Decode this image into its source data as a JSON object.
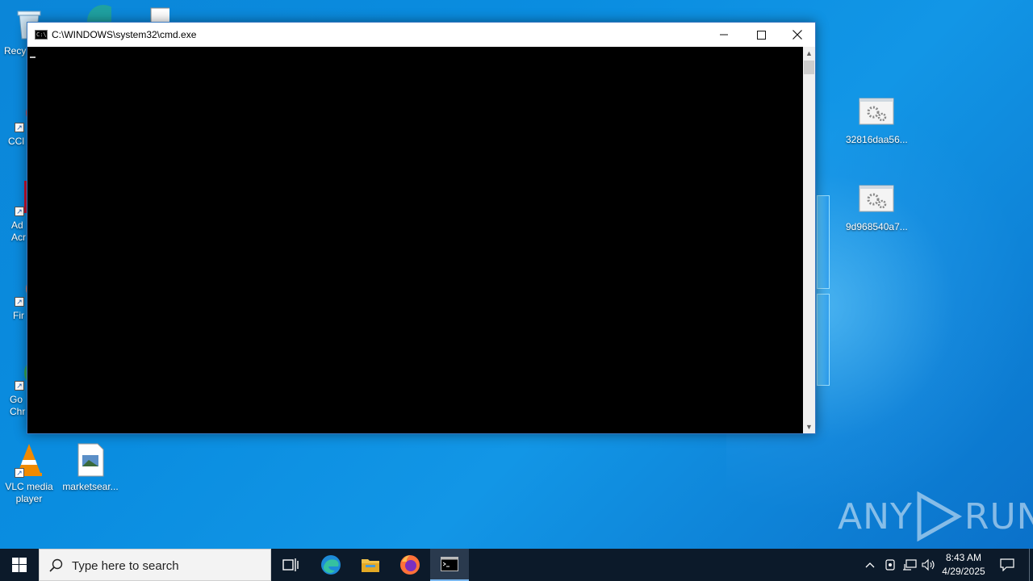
{
  "desktop": {
    "left_icons": [
      {
        "label": "Recy",
        "icon": "recycle-bin-icon"
      },
      {
        "label": "CCl",
        "icon": "ccleaner-icon"
      },
      {
        "label": "Ad\nAcr",
        "icon": "adobe-acrobat-icon"
      },
      {
        "label": "Fir",
        "icon": "firefox-icon"
      },
      {
        "label": "Go\nChr",
        "icon": "chrome-icon"
      },
      {
        "label": "VLC media player",
        "icon": "vlc-icon"
      },
      {
        "label": "marketsear...",
        "icon": "image-file-icon"
      }
    ],
    "right_icons": [
      {
        "label": "32816daa56...",
        "icon": "settings-file-icon"
      },
      {
        "label": "9d968540a7...",
        "icon": "settings-file-icon"
      }
    ]
  },
  "window": {
    "title": "C:\\WINDOWS\\system32\\cmd.exe",
    "icon": "cmd-icon",
    "app_icon_text": "C:\\",
    "console_text": ""
  },
  "watermark": {
    "left": "ANY",
    "right": "RUN"
  },
  "taskbar": {
    "search_placeholder": "Type here to search",
    "apps": [
      "task-view-icon",
      "edge-icon",
      "file-explorer-icon",
      "firefox-icon",
      "cmd-icon"
    ],
    "clock": {
      "time": "8:43 AM",
      "date": "4/29/2025"
    }
  }
}
